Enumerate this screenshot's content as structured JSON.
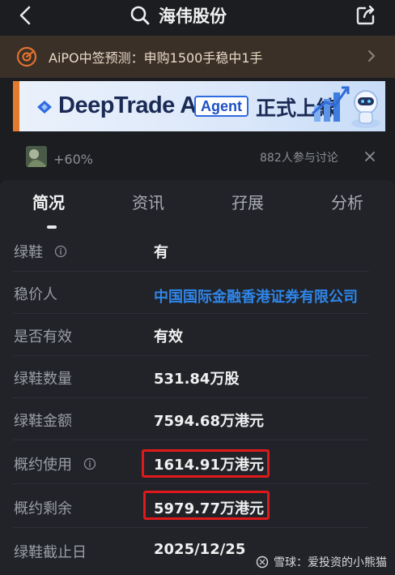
{
  "header": {
    "title": "海伟股份"
  },
  "aipo": {
    "text": "AiPO中签预测：申购1500手稳中1手"
  },
  "banner": {
    "brand": "DeepTrade AI",
    "tag": "Agent",
    "tagline": "正式上線"
  },
  "stats": {
    "change": "+60%",
    "discussion": "882人参与讨论"
  },
  "tabs": [
    {
      "label": "简况",
      "active": true
    },
    {
      "label": "资讯",
      "active": false
    },
    {
      "label": "孖展",
      "active": false
    },
    {
      "label": "分析",
      "active": false
    }
  ],
  "rows": [
    {
      "label": "绿鞋",
      "value": "有",
      "info": true
    },
    {
      "label": "稳价人",
      "value": "中国国际金融香港证券有限公司",
      "info": false,
      "link": true
    },
    {
      "label": "是否有效",
      "value": "有效",
      "info": false
    },
    {
      "label": "绿鞋数量",
      "value": "531.84万股",
      "info": false
    },
    {
      "label": "绿鞋金额",
      "value": "7594.68万港元",
      "info": false
    },
    {
      "label": "概约使用",
      "value": "1614.91万港元",
      "info": true,
      "highlight": true
    },
    {
      "label": "概约剩余",
      "value": "5979.77万港元",
      "info": false,
      "highlight": true
    },
    {
      "label": "绿鞋截止日",
      "value": "2025/12/25",
      "info": false
    }
  ],
  "watermark": {
    "text": "雪球：爱投资的小熊猫"
  },
  "colors": {
    "background": "#1b1d21",
    "link": "#2f86e9",
    "highlight": "#e0191b",
    "aipo_bg": "#3a3028"
  }
}
